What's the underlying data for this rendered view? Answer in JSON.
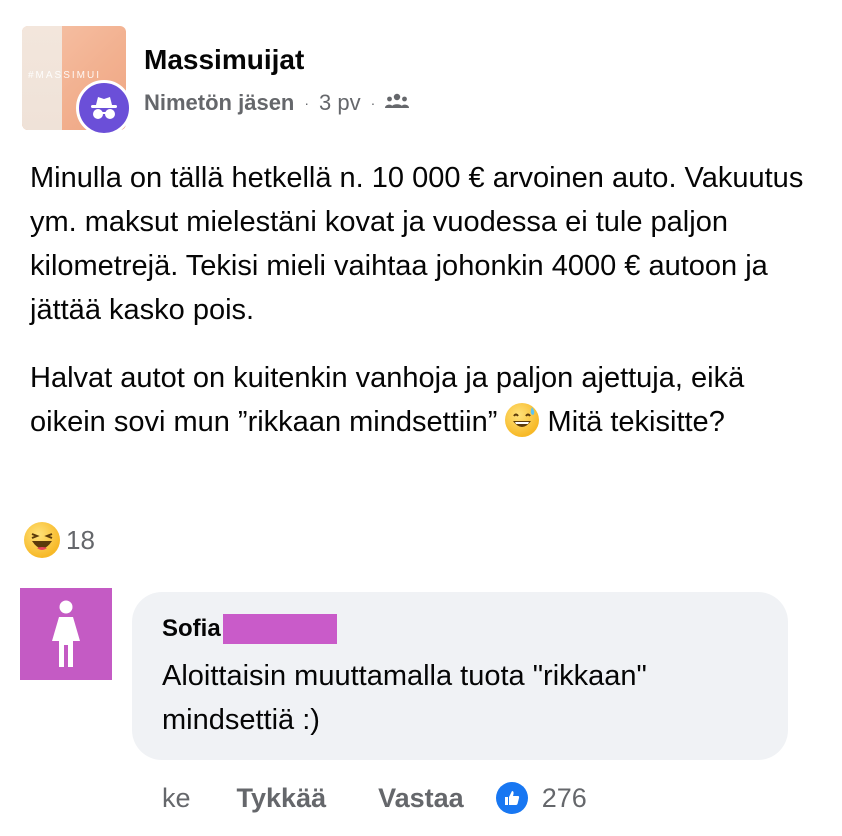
{
  "post": {
    "group_name": "Massimuijat",
    "group_avatar_text": "#MASSIMUI",
    "author": "Nimetön jäsen",
    "time": "3 pv",
    "separator": "·",
    "audience_icon": "group-icon",
    "anon_icon": "incognito-icon",
    "paragraph1": "Minulla on tällä hetkellä n. 10 000 € arvoinen auto. Vakuutus ym. maksut mielestäni kovat ja vuodessa ei tule paljon kilometrejä. Tekisi mieli vaihtaa johonkin 4000 € autoon ja jättää kasko pois.",
    "paragraph2_part1": "Halvat autot on kuitenkin vanhoja ja paljon ajettuja, eikä oikein sovi mun ”rikkaan mindsettiin”",
    "paragraph2_emoji": "grinning-sweat-emoji",
    "paragraph2_part2": "Mitä tekisitte?",
    "reaction_icon": "haha-reaction-icon",
    "reaction_count": "18"
  },
  "comment": {
    "author": "Sofia",
    "avatar_icon": "female-silhouette-icon",
    "text": "Aloittaisin muuttamalla tuota \"rikkaan\" mindsettiä :)",
    "time": "ke",
    "like_label": "Tykkää",
    "reply_label": "Vastaa",
    "like_icon": "thumbs-up-icon",
    "like_count": "276"
  },
  "colors": {
    "accent_purple": "#6b4fd8",
    "redaction": "#c95bc9",
    "like_blue": "#1877f2"
  }
}
